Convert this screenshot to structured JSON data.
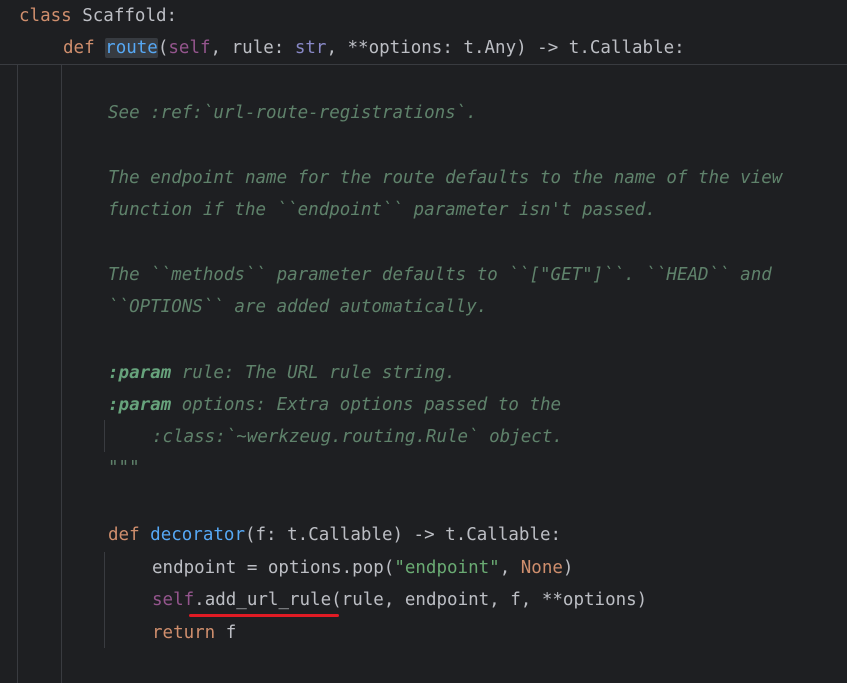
{
  "code": {
    "header": {
      "class_kw": "class",
      "class_name": " Scaffold:",
      "def_kw": "def",
      "fn_name": "route",
      "open_paren": "(",
      "self_kw": "self",
      "params_a": ", rule: ",
      "str_type": "str",
      "params_b": ", **options: t.Any) -> t.Callable:"
    },
    "docstring": {
      "line1": "See :ref:`url-route-registrations`.",
      "line2": "The endpoint name for the route defaults to the name of the view",
      "line3": "function if the ``endpoint`` parameter isn't passed.",
      "line4": "The ``methods`` parameter defaults to ``[\"GET\"]``. ``HEAD`` and",
      "line5": "``OPTIONS`` are added automatically.",
      "param_tag": ":param",
      "param1_text": " rule: The URL rule string.",
      "param2_text": " options: Extra options passed to the",
      "line8": ":class:`~werkzeug.routing.Rule` object.",
      "close": "\"\"\""
    },
    "body": {
      "def_kw": "def",
      "decorator_name": "decorator",
      "decorator_sig": "(f: t.Callable) -> t.Callable:",
      "endpoint_assign": "endpoint = options.pop(",
      "endpoint_str": "\"endpoint\"",
      "comma": ", ",
      "none_kw": "None",
      "close_paren": ")",
      "self_kw": "self",
      "dot": ".",
      "method_name": "add_url_rule",
      "method_args": "(rule, endpoint, f, **options)",
      "return_kw": "return",
      "return_val": " f"
    }
  },
  "colors": {
    "background": "#1e1f22",
    "keyword": "#cf8e6d",
    "function": "#56a8f5",
    "self": "#94558d",
    "string": "#6aab73",
    "docstring": "#5f826b",
    "underline_annotation": "#e01b24"
  }
}
